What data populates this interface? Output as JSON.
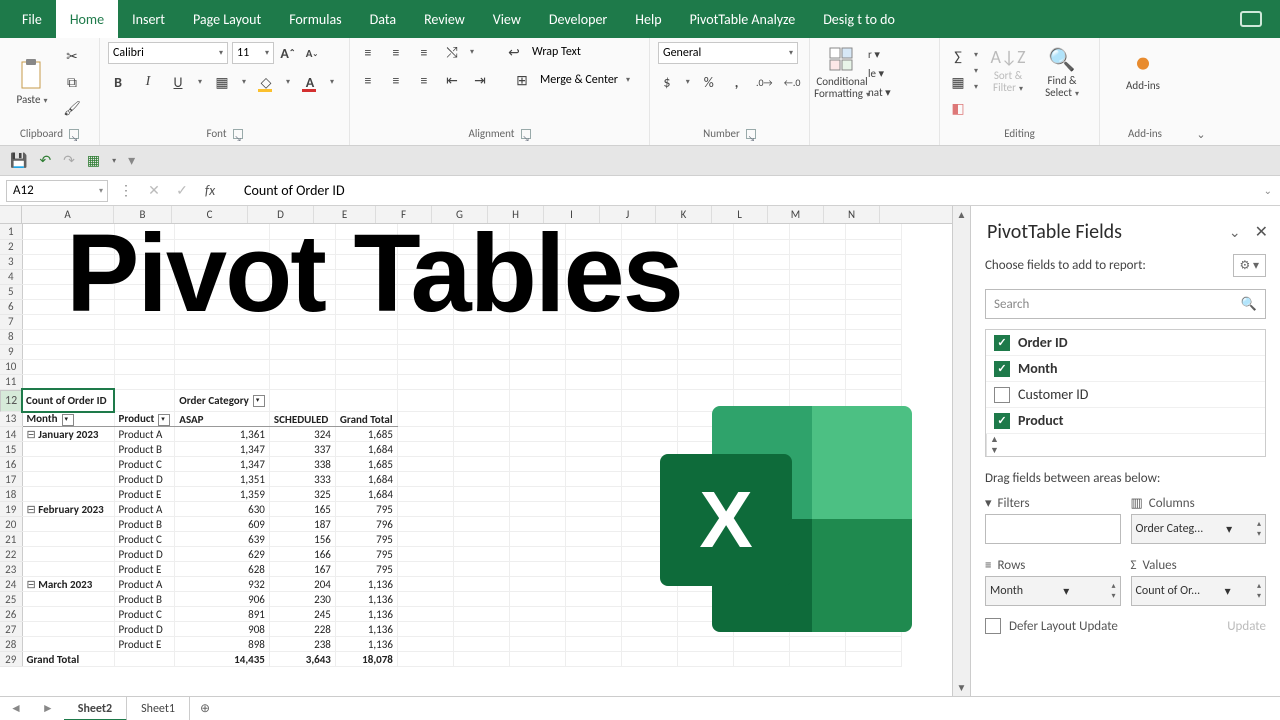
{
  "ribbonTabs": [
    "File",
    "Home",
    "Insert",
    "Page Layout",
    "Formulas",
    "Data",
    "Review",
    "View",
    "Developer",
    "Help",
    "PivotTable Analyze",
    "Desig t to do"
  ],
  "activeTab": "Home",
  "groups": {
    "clipboard": "Clipboard",
    "paste": "Paste",
    "font": "Font",
    "alignment": "Alignment",
    "number": "Number",
    "editing": "Editing",
    "addins": "Add-ins"
  },
  "font": {
    "name": "Calibri",
    "size": "11",
    "wrap": "Wrap Text",
    "merge": "Merge & Center"
  },
  "numberFmt": "General",
  "buttons": {
    "cond": "Conditional Formatting",
    "nat": "nat ▾",
    "sort": "Sort & Filter",
    "find": "Find & Select",
    "addins": "Add-ins"
  },
  "nameBox": "A12",
  "formula": "Count of Order ID",
  "columns": [
    "A",
    "B",
    "C",
    "D",
    "E",
    "F",
    "G",
    "H",
    "I",
    "J",
    "K",
    "L",
    "M",
    "N"
  ],
  "pivot": {
    "r12": {
      "a": "Count of Order ID",
      "c": "Order Category"
    },
    "r13": {
      "a": "Month",
      "b": "Product",
      "c": "ASAP",
      "d": "SCHEDULED",
      "e": "Grand Total"
    },
    "rows": [
      {
        "m": "January 2023",
        "p": "Product A",
        "a": "1,361",
        "s": "324",
        "g": "1,685"
      },
      {
        "m": "",
        "p": "Product B",
        "a": "1,347",
        "s": "337",
        "g": "1,684"
      },
      {
        "m": "",
        "p": "Product C",
        "a": "1,347",
        "s": "338",
        "g": "1,685"
      },
      {
        "m": "",
        "p": "Product D",
        "a": "1,351",
        "s": "333",
        "g": "1,684"
      },
      {
        "m": "",
        "p": "Product E",
        "a": "1,359",
        "s": "325",
        "g": "1,684"
      },
      {
        "m": "February 2023",
        "p": "Product A",
        "a": "630",
        "s": "165",
        "g": "795"
      },
      {
        "m": "",
        "p": "Product B",
        "a": "609",
        "s": "187",
        "g": "796"
      },
      {
        "m": "",
        "p": "Product C",
        "a": "639",
        "s": "156",
        "g": "795"
      },
      {
        "m": "",
        "p": "Product D",
        "a": "629",
        "s": "166",
        "g": "795"
      },
      {
        "m": "",
        "p": "Product E",
        "a": "628",
        "s": "167",
        "g": "795"
      },
      {
        "m": "March 2023",
        "p": "Product A",
        "a": "932",
        "s": "204",
        "g": "1,136"
      },
      {
        "m": "",
        "p": "Product B",
        "a": "906",
        "s": "230",
        "g": "1,136"
      },
      {
        "m": "",
        "p": "Product C",
        "a": "891",
        "s": "245",
        "g": "1,136"
      },
      {
        "m": "",
        "p": "Product D",
        "a": "908",
        "s": "228",
        "g": "1,136"
      },
      {
        "m": "",
        "p": "Product E",
        "a": "898",
        "s": "238",
        "g": "1,136"
      }
    ],
    "grand": {
      "label": "Grand Total",
      "a": "14,435",
      "s": "3,643",
      "g": "18,078"
    }
  },
  "bigTitle": "Pivot Tables",
  "fieldPane": {
    "title": "PivotTable Fields",
    "sub": "Choose fields to add to report:",
    "searchPH": "Search",
    "fields": [
      {
        "label": "Order ID",
        "on": true
      },
      {
        "label": "Month",
        "on": true
      },
      {
        "label": "Customer ID",
        "on": false
      },
      {
        "label": "Product",
        "on": true
      }
    ],
    "drag": "Drag fields between areas below:",
    "filters": "Filters",
    "columns": "Columns",
    "rows": "Rows",
    "values": "Values",
    "colVal": "Order Categ...",
    "rowVal": "Month",
    "valVal": "Count of Or...",
    "defer": "Defer Layout Update",
    "update": "Update"
  },
  "sheets": [
    "Sheet2",
    "Sheet1"
  ],
  "activeSheet": "Sheet2"
}
